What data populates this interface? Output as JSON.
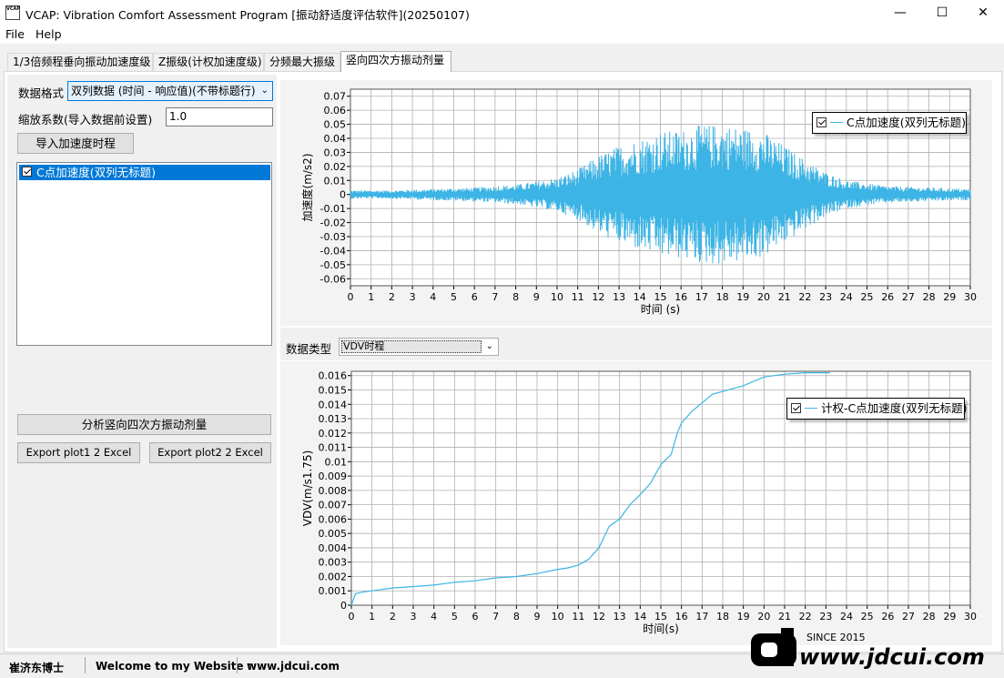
{
  "window": {
    "title": "VCAP: Vibration Comfort Assessment Program [振动舒适度评估软件](20250107)",
    "icon_text": "VCAP",
    "min_glyph": "—",
    "max_glyph": "☐",
    "close_glyph": "✕"
  },
  "menu": [
    "File",
    "Help"
  ],
  "tabs": [
    "1/3倍频程垂向振动加速度级",
    "Z振级(计权加速度级)",
    "分频最大振级",
    "竖向四次方振动剂量"
  ],
  "left": {
    "format_label": "数据格式",
    "format_value": "双列数据 (时间 - 响应值)(不带标题行)",
    "scale_label": "缩放系数(导入数据前设置)",
    "scale_value": "1.0",
    "import_button": "导入加速度时程",
    "list_items": [
      {
        "label": "C点加速度(双列无标题)",
        "checked": true
      }
    ],
    "analyze_button": "分析竖向四次方振动剂量",
    "export1": "Export plot1 2 Excel",
    "export2": "Export plot2 2 Excel"
  },
  "plot1_legend": "C点加速度(双列无标题)",
  "plot2_legend": "计权-C点加速度(双列无标题)",
  "datatype_label": "数据类型",
  "datatype_value": "VDV时程",
  "status": {
    "author": "崔济东博士",
    "welcome": "Welcome to my Website :",
    "url": "www.jdcui.com"
  },
  "watermark": {
    "since": "SINCE 2015",
    "site": "www.jdcui.com"
  },
  "colors": {
    "series": "#3cb4e5",
    "selection": "#0078d7",
    "grid": "#b0b0b0"
  },
  "chart_data": [
    {
      "type": "line",
      "ylabel": "加速度(m/s2)",
      "xlabel": "时间 (s)",
      "xlim": [
        0,
        30
      ],
      "ylim": [
        -0.065,
        0.075
      ],
      "xticks": [
        0,
        1,
        2,
        3,
        4,
        5,
        6,
        7,
        8,
        9,
        10,
        11,
        12,
        13,
        14,
        15,
        16,
        17,
        18,
        19,
        20,
        21,
        22,
        23,
        24,
        25,
        26,
        27,
        28,
        29,
        30
      ],
      "yticks": [
        -0.06,
        -0.05,
        -0.04,
        -0.03,
        -0.02,
        -0.01,
        0,
        0.01,
        0.02,
        0.03,
        0.04,
        0.05,
        0.06,
        0.07
      ],
      "grid": true,
      "legend_position": "top-right",
      "series": [
        {
          "name": "C点加速度(双列无标题)",
          "envelope_t": [
            0,
            2,
            4,
            6,
            8,
            10,
            11,
            12,
            13,
            14,
            15,
            16,
            17,
            18,
            19,
            20,
            21,
            22,
            23,
            24,
            26,
            28,
            30
          ],
          "envelope_amp": [
            0.003,
            0.003,
            0.004,
            0.005,
            0.007,
            0.012,
            0.018,
            0.028,
            0.035,
            0.04,
            0.045,
            0.046,
            0.05,
            0.05,
            0.048,
            0.045,
            0.035,
            0.025,
            0.016,
            0.01,
            0.006,
            0.005,
            0.004
          ]
        }
      ]
    },
    {
      "type": "line",
      "ylabel": "VDV(m/s1.75)",
      "xlabel": "时间(s)",
      "xlim": [
        0,
        30
      ],
      "ylim": [
        0,
        0.0163
      ],
      "xticks": [
        0,
        1,
        2,
        3,
        4,
        5,
        6,
        7,
        8,
        9,
        10,
        11,
        12,
        13,
        14,
        15,
        16,
        17,
        18,
        19,
        20,
        21,
        22,
        23,
        24,
        25,
        26,
        27,
        28,
        29,
        30
      ],
      "yticks": [
        0,
        0.001,
        0.002,
        0.003,
        0.004,
        0.005,
        0.006,
        0.007,
        0.008,
        0.009,
        0.01,
        0.011,
        0.012,
        0.013,
        0.014,
        0.015,
        0.016
      ],
      "grid": true,
      "legend_position": "top-right",
      "series": [
        {
          "name": "计权-C点加速度(双列无标题)",
          "x": [
            0,
            0.2,
            0.5,
            1,
            2,
            3,
            4,
            5,
            6,
            7,
            8,
            9,
            10,
            10.5,
            11,
            11.5,
            12,
            12.5,
            13,
            13.5,
            14,
            14.5,
            15,
            15.5,
            15.8,
            16,
            16.5,
            17,
            17.5,
            18,
            18.5,
            19,
            19.5,
            20,
            20.5,
            21,
            22,
            23.2
          ],
          "y": [
            0,
            0.0008,
            0.0009,
            0.001,
            0.0012,
            0.0013,
            0.0014,
            0.0016,
            0.0017,
            0.0019,
            0.002,
            0.0022,
            0.0025,
            0.0026,
            0.0028,
            0.0032,
            0.004,
            0.0055,
            0.006,
            0.007,
            0.0077,
            0.0085,
            0.0098,
            0.0105,
            0.012,
            0.0127,
            0.0135,
            0.0141,
            0.0147,
            0.0149,
            0.0151,
            0.0153,
            0.0156,
            0.0159,
            0.016,
            0.0161,
            0.0162,
            0.0162
          ]
        }
      ]
    }
  ]
}
